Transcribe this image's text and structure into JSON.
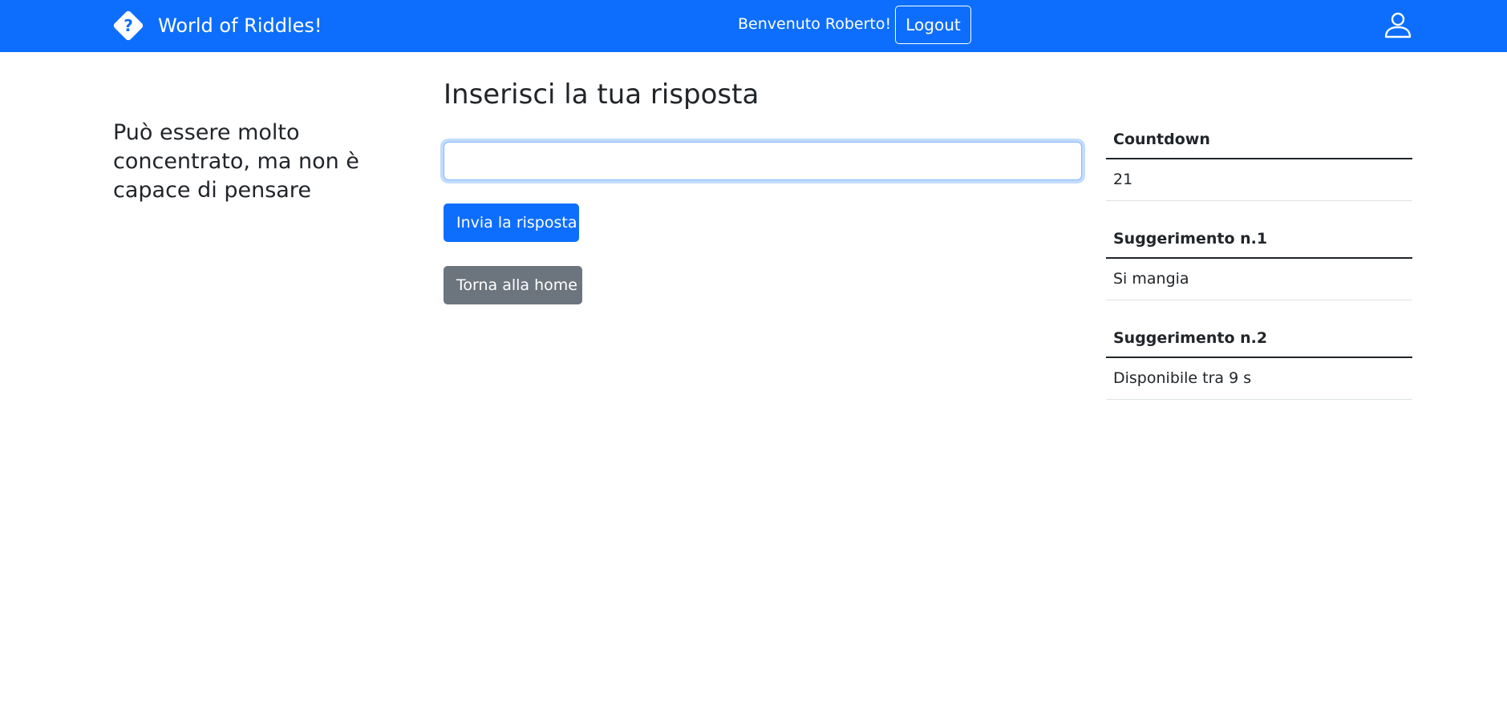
{
  "navbar": {
    "brand_title": "World of Riddles!",
    "brand_icon": "question-diamond-icon",
    "welcome_text": "Benvenuto Roberto!",
    "logout_label": "Logout",
    "user_icon": "person-icon",
    "background_color": "#0d6efd"
  },
  "riddle": {
    "text": "Può essere molto concentrato, ma non è capace di pensare"
  },
  "answer": {
    "title": "Inserisci la tua risposta",
    "input_value": "",
    "submit_label": "Invia la risposta",
    "home_label": "Torna alla home"
  },
  "info": {
    "countdown_header": "Countdown",
    "countdown_value": "21",
    "hint1_header": "Suggerimento n.1",
    "hint1_value": "Si mangia",
    "hint2_header": "Suggerimento n.2",
    "hint2_value": "Disponibile tra 9 s"
  },
  "colors": {
    "primary": "#0d6efd",
    "secondary": "#6c757d",
    "text": "#212529"
  }
}
